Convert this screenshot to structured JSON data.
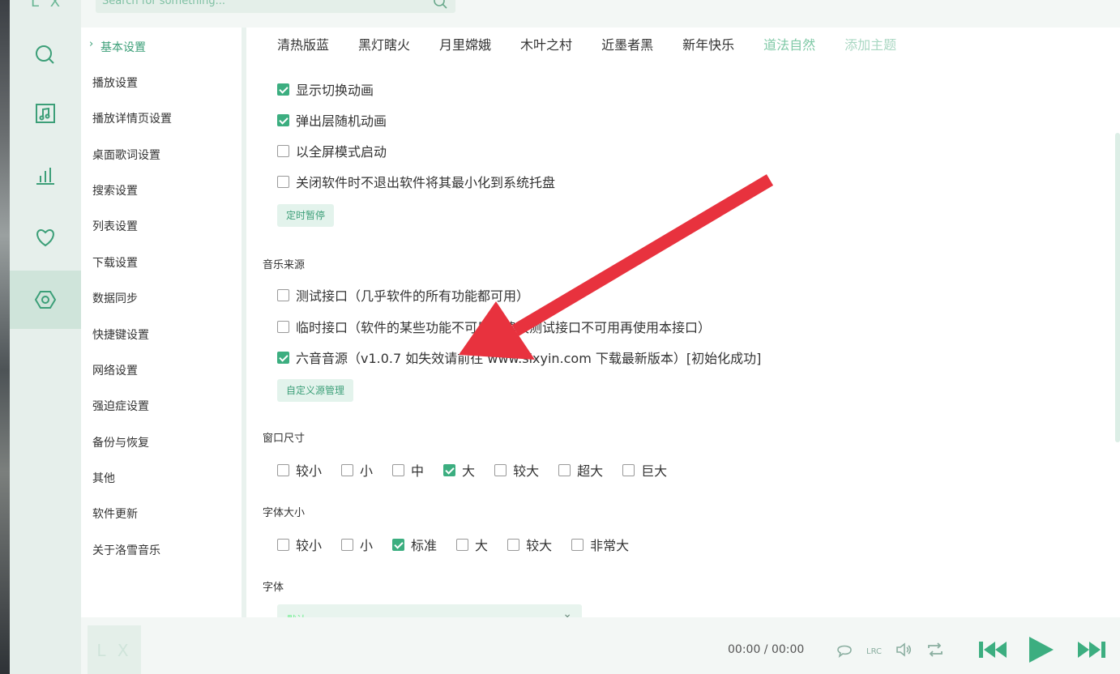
{
  "app": {
    "logo": "L X",
    "search_placeholder": "Search for something..."
  },
  "rail": {
    "items": [
      {
        "name": "search",
        "icon": "search-icon"
      },
      {
        "name": "music-library",
        "icon": "music-note-icon"
      },
      {
        "name": "charts",
        "icon": "bar-chart-icon"
      },
      {
        "name": "favorites",
        "icon": "heart-icon"
      },
      {
        "name": "settings",
        "icon": "settings-icon",
        "active": true
      }
    ]
  },
  "nav": {
    "items": [
      {
        "label": "基本设置",
        "active": true
      },
      {
        "label": "播放设置"
      },
      {
        "label": "播放详情页设置"
      },
      {
        "label": "桌面歌词设置"
      },
      {
        "label": "搜索设置"
      },
      {
        "label": "列表设置"
      },
      {
        "label": "下载设置"
      },
      {
        "label": "数据同步"
      },
      {
        "label": "快捷键设置"
      },
      {
        "label": "网络设置"
      },
      {
        "label": "强迫症设置"
      },
      {
        "label": "备份与恢复"
      },
      {
        "label": "其他"
      },
      {
        "label": "软件更新"
      },
      {
        "label": "关于洛雪音乐"
      }
    ]
  },
  "themes": [
    "清热版蓝",
    "黑灯瞎火",
    "月里嫦娥",
    "木叶之村",
    "近墨者黑",
    "新年快乐",
    "道法自然",
    "添加主题"
  ],
  "basic": {
    "opts": [
      {
        "label": "显示切换动画",
        "checked": true
      },
      {
        "label": "弹出层随机动画",
        "checked": true
      },
      {
        "label": "以全屏模式启动",
        "checked": false
      },
      {
        "label": "关闭软件时不退出软件将其最小化到系统托盘",
        "checked": false
      }
    ],
    "timer_button": "定时暂停"
  },
  "source": {
    "section": "音乐来源",
    "opts": [
      {
        "label": "测试接口（几乎软件的所有功能都可用）",
        "checked": false
      },
      {
        "label": "临时接口（软件的某些功能不可用，建议测试接口不可用再使用本接口）",
        "checked": false
      },
      {
        "label": "六音音源（v1.0.7 如失效请前往 www.sixyin.com 下载最新版本）[初始化成功]",
        "checked": true
      }
    ],
    "custom_button": "自定义源管理"
  },
  "window_size": {
    "section": "窗口尺寸",
    "opts": [
      {
        "label": "较小",
        "checked": false
      },
      {
        "label": "小",
        "checked": false
      },
      {
        "label": "中",
        "checked": false
      },
      {
        "label": "大",
        "checked": true
      },
      {
        "label": "较大",
        "checked": false
      },
      {
        "label": "超大",
        "checked": false
      },
      {
        "label": "巨大",
        "checked": false
      }
    ]
  },
  "font_size": {
    "section": "字体大小",
    "opts": [
      {
        "label": "较小",
        "checked": false
      },
      {
        "label": "小",
        "checked": false
      },
      {
        "label": "标准",
        "checked": true
      },
      {
        "label": "大",
        "checked": false
      },
      {
        "label": "较大",
        "checked": false
      },
      {
        "label": "非常大",
        "checked": false
      }
    ]
  },
  "font": {
    "section": "字体",
    "value": "默认"
  },
  "player": {
    "logo": "L X",
    "time": "00:00 / 00:00",
    "icons": [
      "comment-icon",
      "lyrics-icon",
      "volume-icon",
      "repeat-icon",
      "previous-icon",
      "play-icon",
      "next-icon"
    ]
  },
  "colors": {
    "accent": "#3cae80",
    "arrow": "#e8323e"
  }
}
